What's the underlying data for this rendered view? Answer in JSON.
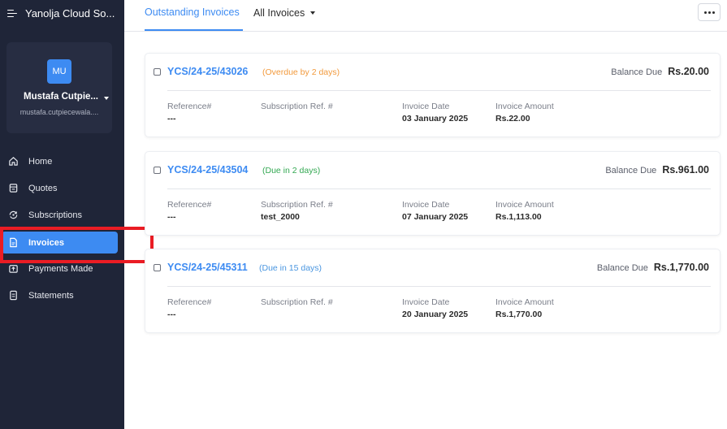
{
  "sidebar": {
    "org_name": "Yanolja Cloud So...",
    "profile": {
      "initials": "MU",
      "name": "Mustafa Cutpie...",
      "email": "mustafa.cutpiecewala...."
    },
    "nav": [
      {
        "label": "Home",
        "icon": "home-icon"
      },
      {
        "label": "Quotes",
        "icon": "quotes-icon"
      },
      {
        "label": "Subscriptions",
        "icon": "subscriptions-icon"
      },
      {
        "label": "Invoices",
        "icon": "invoice-icon",
        "active": true
      },
      {
        "label": "Payments Made",
        "icon": "payments-icon"
      },
      {
        "label": "Statements",
        "icon": "statements-icon"
      }
    ]
  },
  "header": {
    "tab_active": "Outstanding Invoices",
    "tab_filter": "All Invoices",
    "more_icon": "ellipsis-icon"
  },
  "invoices": [
    {
      "number": "YCS/24-25/43026",
      "status": "(Overdue by 2 days)",
      "status_color": "#f29a3d",
      "balance_label": "Balance Due",
      "balance": "Rs.20.00",
      "reference_label": "Reference#",
      "reference": "---",
      "subscription_label": "Subscription Ref. #",
      "subscription": "",
      "date_label": "Invoice Date",
      "date": "03 January 2025",
      "amount_label": "Invoice Amount",
      "amount": "Rs.22.00"
    },
    {
      "number": "YCS/24-25/43504",
      "status": "(Due in 2 days)",
      "status_color": "#33a852",
      "balance_label": "Balance Due",
      "balance": "Rs.961.00",
      "reference_label": "Reference#",
      "reference": "---",
      "subscription_label": "Subscription Ref. #",
      "subscription": "test_2000",
      "date_label": "Invoice Date",
      "date": "07 January 2025",
      "amount_label": "Invoice Amount",
      "amount": "Rs.1,113.00"
    },
    {
      "number": "YCS/24-25/45311",
      "status": "(Due in 15 days)",
      "status_color": "#4a96e0",
      "balance_label": "Balance Due",
      "balance": "Rs.1,770.00",
      "reference_label": "Reference#",
      "reference": "---",
      "subscription_label": "Subscription Ref. #",
      "subscription": "",
      "date_label": "Invoice Date",
      "date": "20 January 2025",
      "amount_label": "Invoice Amount",
      "amount": "Rs.1,770.00"
    }
  ],
  "colors": {
    "sidebar_bg": "#1f2538",
    "accent": "#3d8bf2",
    "highlight": "#ea1c24"
  }
}
